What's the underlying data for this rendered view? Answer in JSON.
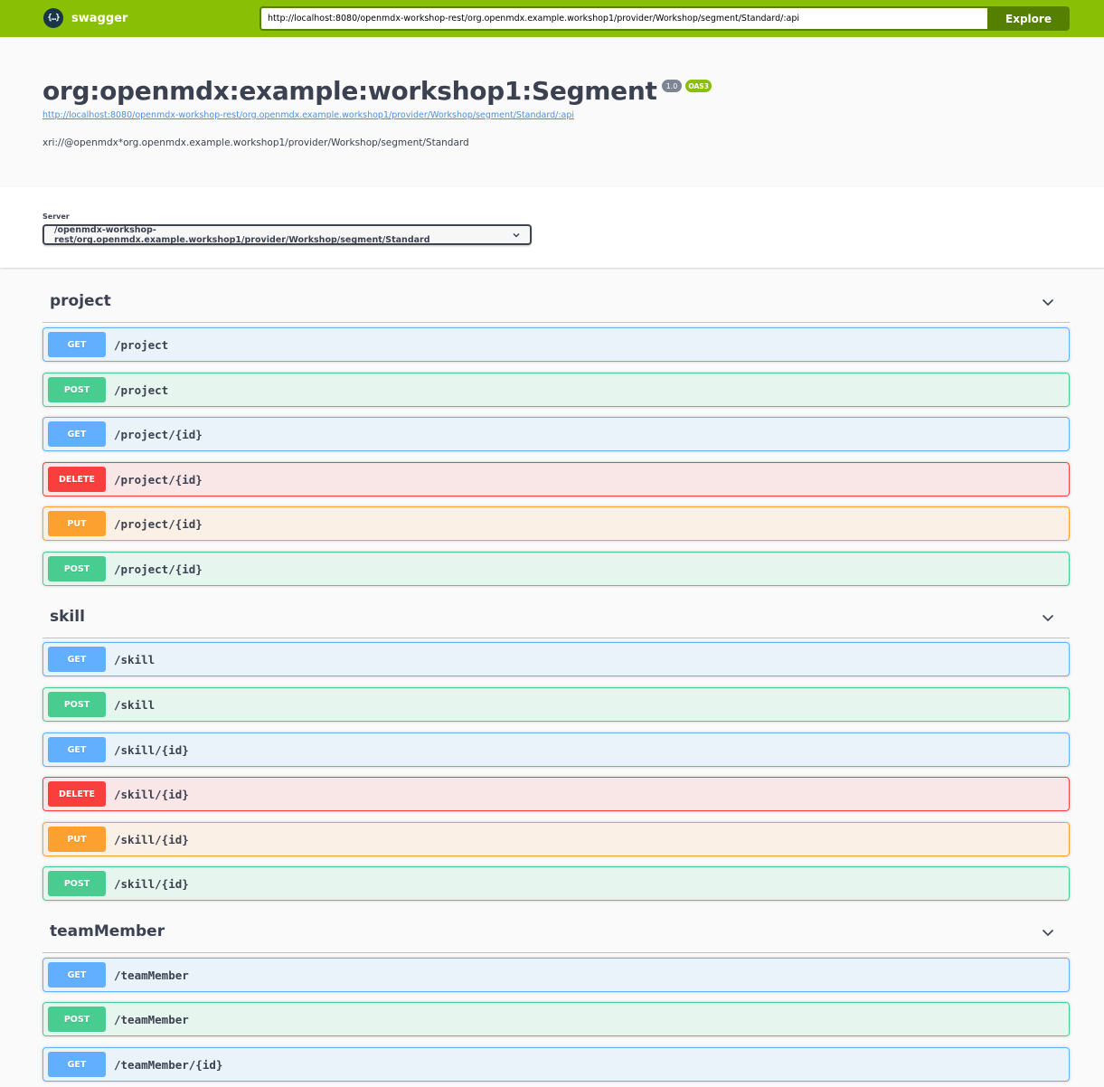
{
  "topbar": {
    "logo_glyph": "{…}",
    "logo_text": "swagger",
    "url_value": "http://localhost:8080/openmdx-workshop-rest/org.openmdx.example.workshop1/provider/Workshop/segment/Standard/:api",
    "explore_label": "Explore",
    "accent_color": "#89bf04"
  },
  "info": {
    "title": "org:openmdx:example:workshop1:Segment",
    "version_badge": "1.0",
    "oas_badge": "OAS3",
    "spec_url": "http://localhost:8080/openmdx-workshop-rest/org.openmdx.example.workshop1/provider/Workshop/segment/Standard/:api",
    "description": "xri://@openmdx*org.openmdx.example.workshop1/provider/Workshop/segment/Standard"
  },
  "servers": {
    "label": "Server",
    "selected": "/openmdx-workshop-rest/org.openmdx.example.workshop1/provider/Workshop/segment/Standard"
  },
  "method_colors": {
    "GET": "#61affe",
    "POST": "#49cc90",
    "DELETE": "#f93e3e",
    "PUT": "#fca130"
  },
  "tags": [
    {
      "name": "project",
      "operations": [
        {
          "method": "GET",
          "path": "/project"
        },
        {
          "method": "POST",
          "path": "/project"
        },
        {
          "method": "GET",
          "path": "/project/{id}"
        },
        {
          "method": "DELETE",
          "path": "/project/{id}"
        },
        {
          "method": "PUT",
          "path": "/project/{id}"
        },
        {
          "method": "POST",
          "path": "/project/{id}"
        }
      ]
    },
    {
      "name": "skill",
      "operations": [
        {
          "method": "GET",
          "path": "/skill"
        },
        {
          "method": "POST",
          "path": "/skill"
        },
        {
          "method": "GET",
          "path": "/skill/{id}"
        },
        {
          "method": "DELETE",
          "path": "/skill/{id}"
        },
        {
          "method": "PUT",
          "path": "/skill/{id}"
        },
        {
          "method": "POST",
          "path": "/skill/{id}"
        }
      ]
    },
    {
      "name": "teamMember",
      "operations": [
        {
          "method": "GET",
          "path": "/teamMember"
        },
        {
          "method": "POST",
          "path": "/teamMember"
        },
        {
          "method": "GET",
          "path": "/teamMember/{id}"
        }
      ]
    }
  ]
}
